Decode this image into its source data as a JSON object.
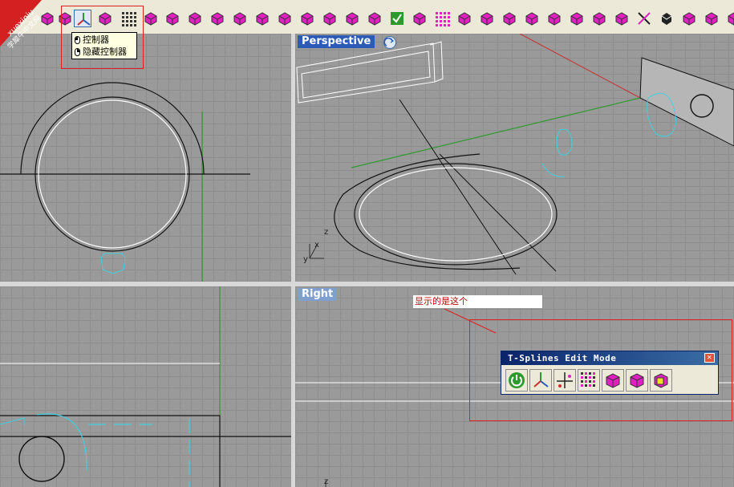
{
  "viewports": {
    "perspective": {
      "label": "Perspective"
    },
    "right": {
      "label": "Right"
    }
  },
  "tooltip": {
    "items": [
      "控制器",
      "隐藏控制器"
    ]
  },
  "annotation": {
    "text": "显示的是这个"
  },
  "tsplines_panel": {
    "title": "T-Splines Edit Mode",
    "tools": [
      "power-icon",
      "gumball-icon",
      "manipulator-icon",
      "grid-points-icon",
      "cube-icon",
      "cube-face-icon",
      "cube-yellow-icon"
    ]
  },
  "watermark": {
    "line1": "xuexiniu",
    "line2": "学犀牛中文网"
  },
  "axes": {
    "x": "x",
    "y": "y",
    "z": "z"
  },
  "colors": {
    "accent_magenta": "#e020c0",
    "viewport_active": "#2b5ab7",
    "viewport_inactive": "#7f9fce",
    "annotation_red": "#e02020",
    "curve_cyan": "#40d0e0",
    "axis_green": "#2e9a2e",
    "axis_red": "#c83030"
  }
}
